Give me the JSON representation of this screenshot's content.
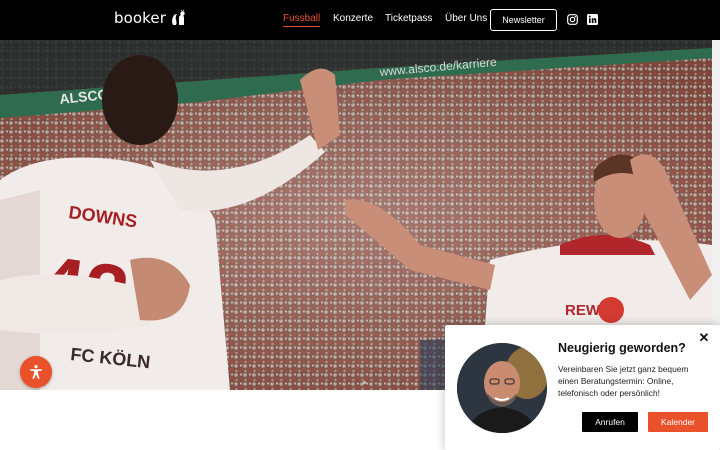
{
  "header": {
    "logo_text": "booker",
    "nav": [
      {
        "label": "Fussball"
      },
      {
        "label": "Konzerte"
      },
      {
        "label": "Ticketpass"
      },
      {
        "label": "Über Uns"
      }
    ],
    "newsletter_label": "Newsletter",
    "social_icons": [
      "instagram-icon",
      "linkedin-icon"
    ]
  },
  "hero": {
    "image": "stadium-football-celebration-photo",
    "shirt_name": "DOWNS",
    "shirt_number": "42",
    "shirt_text": "FC KÖLN",
    "sponsor": "REWE",
    "banner": "www.alsco.de/karriere",
    "banner_brand": "ALSCO"
  },
  "accessibility_icon": "accessibility-icon",
  "popup": {
    "title": "Neugierig geworden?",
    "text": "Vereinbaren Sie jetzt ganz bequem einen Beratungstermin: Online, telefonisch oder persönlich!",
    "close_label": "✕",
    "call_label": "Anrufen",
    "calendar_label": "Kalender"
  },
  "colors": {
    "accent": "#e8512a",
    "header_bg": "#000000"
  }
}
